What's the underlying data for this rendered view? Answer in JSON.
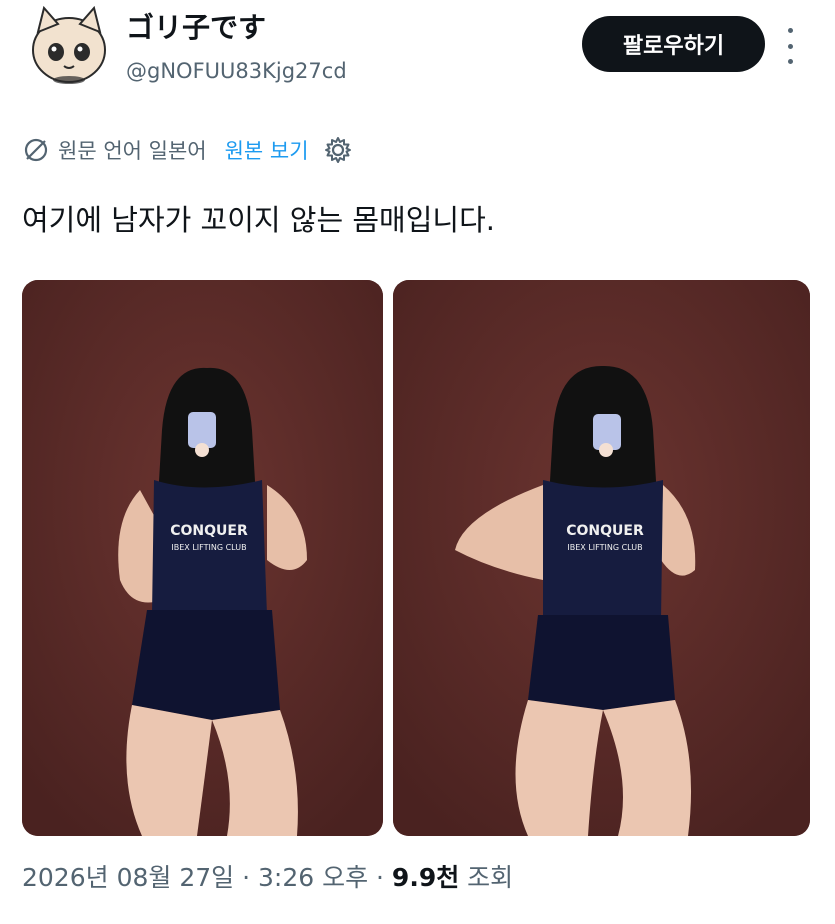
{
  "user": {
    "display_name": "ゴリ子です",
    "handle": "@gNOFUU83Kjg27cd",
    "avatar_icon": "cartoon-cat-avatar"
  },
  "actions": {
    "follow_label": "팔로우하기",
    "more_icon": "more-vertical-icon"
  },
  "translation": {
    "icon": "translate-slash-icon",
    "source_language": "원문 언어 일본어",
    "show_original": "원본 보기",
    "settings_icon": "gear-icon"
  },
  "tweet": {
    "text": "여기에 남자가 꼬이지 않는 몸매입니다.",
    "photos": [
      {
        "shirt_text": "CONQUER",
        "shirt_sub": "IBEX LIFTING CLUB"
      },
      {
        "shirt_text": "CONQUER",
        "shirt_sub": "IBEX LIFTING CLUB"
      }
    ]
  },
  "meta": {
    "date": "2026년 08월 27일",
    "sep1": " · ",
    "time": "3:26 오후",
    "sep2": " · ",
    "views_count": "9.9천",
    "views_label": " 조회"
  },
  "colors": {
    "text": "#0f1419",
    "secondary": "#536471",
    "link": "#1d9bf0",
    "button_bg": "#0f1419",
    "photo_bg": "#5a2a27"
  }
}
